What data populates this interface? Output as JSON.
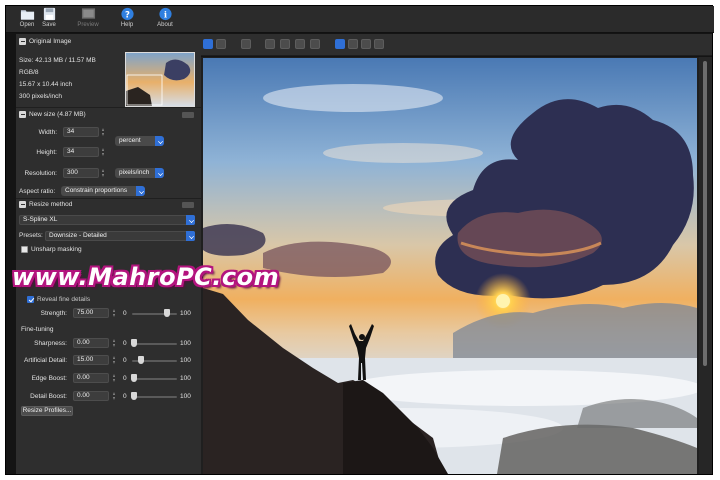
{
  "toolbar": {
    "open": "Open",
    "save": "Save",
    "preview": "Preview",
    "help": "Help",
    "about": "About"
  },
  "panel": {
    "original_image": {
      "title": "Original Image",
      "size": "Size: 42.13 MB / 11.57 MB",
      "mode": "RGB/8",
      "dimensions": "15.67 x 10.44 inch",
      "resolution": "300 pixels/inch"
    },
    "new_size": {
      "title": "New size (4.87 MB)",
      "width_label": "Width:",
      "width_value": "34",
      "height_label": "Height:",
      "height_value": "34",
      "unit": "percent",
      "resolution_label": "Resolution:",
      "resolution_value": "300",
      "resolution_unit": "pixels/inch",
      "aspect_label": "Aspect ratio:",
      "aspect_value": "Constrain proportions"
    },
    "resize_method": {
      "title": "Resize method",
      "method": "S-Spline XL",
      "presets_label": "Presets:",
      "presets_value": "Downsize - Detailed",
      "unsharp_label": "Unsharp masking",
      "reveal_label": "Reveal fine details",
      "strength_label": "Strength:",
      "strength_value": "75.00",
      "strength_min": "0",
      "strength_max": "100",
      "strength_level": 0.75
    },
    "fine_tuning": {
      "title": "Fine-tuning",
      "rows": [
        {
          "label": "Sharpness:",
          "value": "0.00",
          "min": "0",
          "max": "100",
          "level": 0.0
        },
        {
          "label": "Artificial Detail:",
          "value": "15.00",
          "min": "0",
          "max": "100",
          "level": 0.15
        },
        {
          "label": "Edge Boost:",
          "value": "0.00",
          "min": "0",
          "max": "100",
          "level": 0.0
        },
        {
          "label": "Detail Boost:",
          "value": "0.00",
          "min": "0",
          "max": "100",
          "level": 0.0
        }
      ],
      "profiles_button": "Resize Profiles..."
    }
  },
  "watermark": "www.MahroPC.com",
  "colors": {
    "accent": "#2f6fd6",
    "panel_bg": "#2e2e2e",
    "watermark_outline": "#b3147e"
  }
}
